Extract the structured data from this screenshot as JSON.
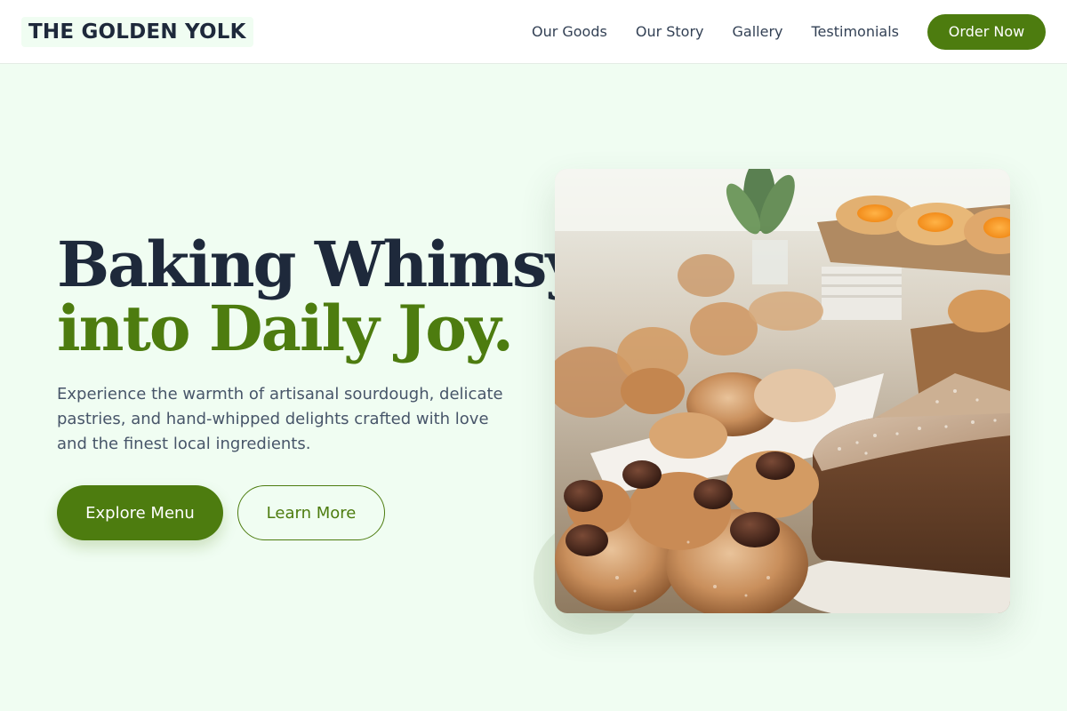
{
  "brand": {
    "name": "THE GOLDEN YOLK"
  },
  "nav": {
    "items": [
      {
        "label": "Our Goods"
      },
      {
        "label": "Our Story"
      },
      {
        "label": "Gallery"
      },
      {
        "label": "Testimonials"
      }
    ],
    "cta_label": "Order Now"
  },
  "hero": {
    "headline_line1": "Baking Whimsy",
    "headline_line2": "into Daily Joy.",
    "subtext": "Experience the warmth of artisanal sourdough, delicate pastries, and hand-whipped delights crafted with love and the finest local ingredients.",
    "primary_button": "Explore Menu",
    "secondary_button": "Learn More",
    "image_icon": "bakery-pastries-photo"
  },
  "colors": {
    "accent": "#4d7c0f",
    "heading": "#1e293b",
    "background": "#f0fdf2",
    "body_text": "#475569"
  }
}
